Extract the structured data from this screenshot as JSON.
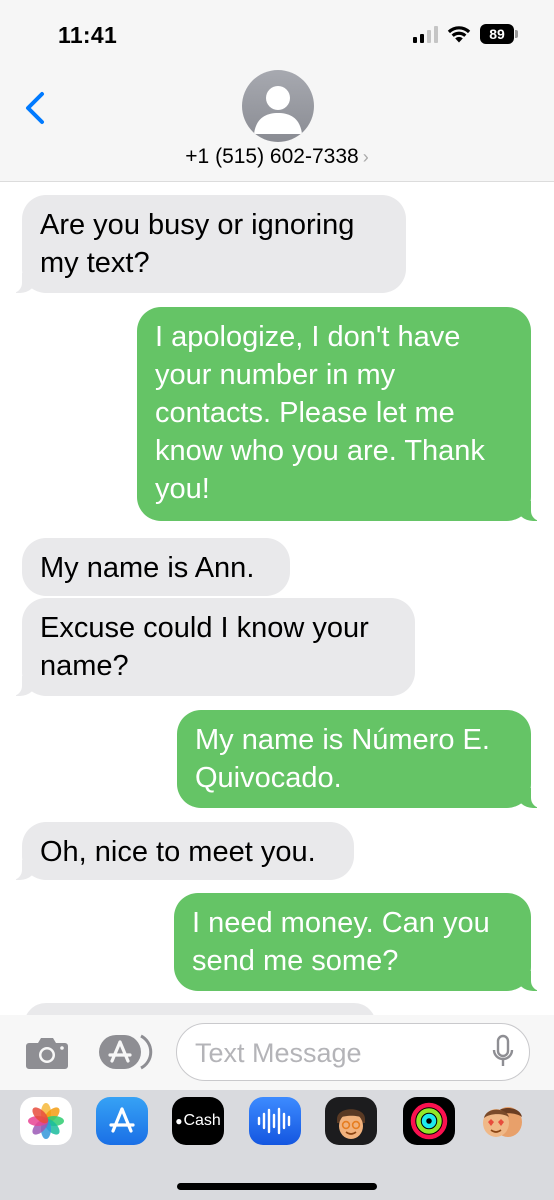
{
  "status_bar": {
    "time": "11:41",
    "battery": "89"
  },
  "header": {
    "contact": "+1 (515) 602-7338",
    "chevron": "›"
  },
  "messages": [
    {
      "text": "Are you busy or ignoring my text?"
    },
    {
      "text": "I apologize, I don't have your number in my contacts. Please let me know who you are. Thank you!"
    },
    {
      "text": "My name is Ann."
    },
    {
      "text": "Excuse could I know your name?"
    },
    {
      "text": "My name is Número E. Quivocado."
    },
    {
      "text": "Oh, nice to meet you."
    },
    {
      "text": "I need money. Can you send me some?"
    }
  ],
  "composer": {
    "placeholder": "Text Message"
  },
  "app_drawer": [
    {
      "icon": "photos-icon"
    },
    {
      "icon": "app-store-icon"
    },
    {
      "icon": "apple-cash-icon",
      "label": "Cash"
    },
    {
      "icon": "audio-message-icon"
    },
    {
      "icon": "memoji-icon"
    },
    {
      "icon": "activity-icon"
    },
    {
      "icon": "memoji-stickers-icon"
    }
  ],
  "colors": {
    "incoming": "#e9e9eb",
    "outgoing": "#65c466",
    "accent": "#007aff"
  }
}
